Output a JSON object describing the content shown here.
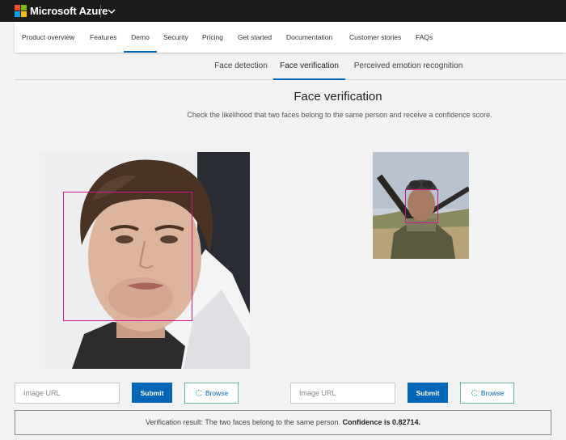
{
  "brand": {
    "name": "Microsoft Azure",
    "logo_colors": [
      "#f25022",
      "#7fba00",
      "#00a4ef",
      "#ffb900"
    ],
    "menu_icon": "chevron-down-icon"
  },
  "nav": {
    "items": [
      {
        "label": "Product overview",
        "active": false
      },
      {
        "label": "Features",
        "active": false
      },
      {
        "label": "Demo",
        "active": true
      },
      {
        "label": "Security",
        "active": false
      },
      {
        "label": "Pricing",
        "active": false
      },
      {
        "label": "Get started",
        "active": false
      },
      {
        "label": "Documentation",
        "active": false
      },
      {
        "label": "Customer stories",
        "active": false
      },
      {
        "label": "FAQs",
        "active": false
      }
    ]
  },
  "subtabs": {
    "items": [
      {
        "label": "Face detection",
        "active": false
      },
      {
        "label": "Face verification",
        "active": true
      },
      {
        "label": "Perceived emotion recognition",
        "active": false
      }
    ]
  },
  "main": {
    "title": "Face verification",
    "subtitle": "Check the likelihood that two faces belong to the same person and receive a confidence score."
  },
  "left_panel": {
    "url_placeholder": "Image URL",
    "submit_label": "Submit",
    "browse_label": "Browse"
  },
  "right_panel": {
    "url_placeholder": "Image URL",
    "submit_label": "Submit",
    "browse_label": "Browse"
  },
  "result": {
    "text": "Verification result: The two faces belong to the same person.",
    "confidence": "Confidence is 0.82714."
  },
  "colors": {
    "accent": "#0067b8",
    "face_box": "#d4148a",
    "topbar": "#1b1b1b"
  }
}
